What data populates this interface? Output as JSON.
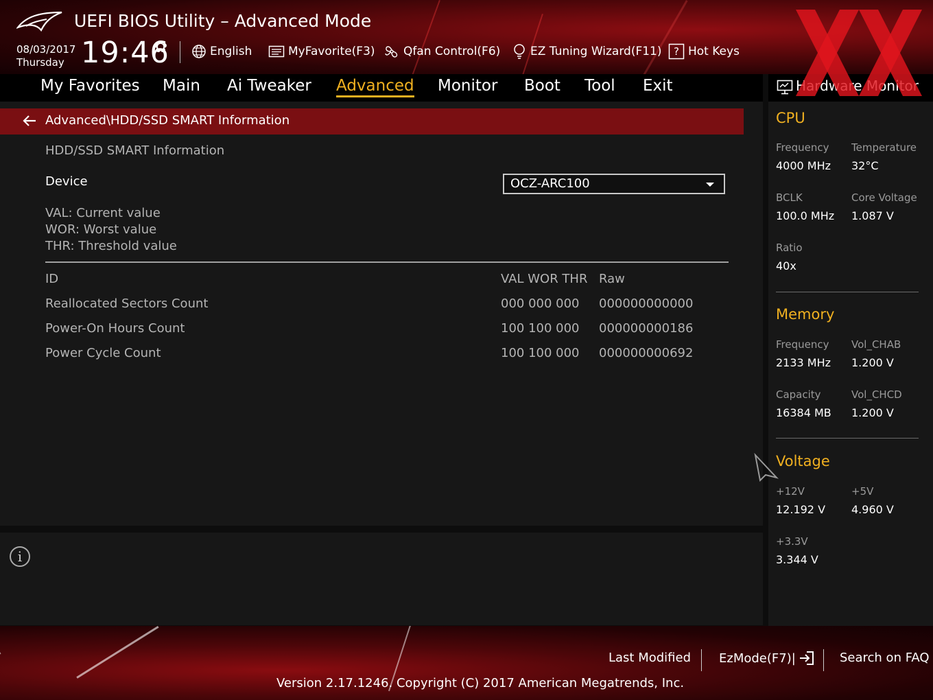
{
  "header": {
    "title": "UEFI BIOS Utility – Advanced Mode",
    "date": "08/03/2017",
    "weekday": "Thursday",
    "time": "19:46",
    "toolbar": {
      "language": "English",
      "my_favorite": "MyFavorite(F3)",
      "qfan": "Qfan Control(F6)",
      "ez_tuning": "EZ Tuning Wizard(F11)",
      "hot_keys": "Hot Keys"
    }
  },
  "nav": {
    "tabs": [
      "My Favorites",
      "Main",
      "Ai Tweaker",
      "Advanced",
      "Monitor",
      "Boot",
      "Tool",
      "Exit"
    ],
    "active": "Advanced"
  },
  "main": {
    "breadcrumb": "Advanced\\HDD/SSD SMART Information",
    "section_title": "HDD/SSD SMART Information",
    "device_label": "Device",
    "device_value": "OCZ-ARC100",
    "legend": [
      "VAL:  Current value",
      "WOR: Worst value",
      "THR:  Threshold value"
    ],
    "table": {
      "headers": {
        "id": "ID",
        "vals": "VAL WOR THR",
        "raw": "Raw"
      },
      "rows": [
        {
          "name": "Reallocated Sectors Count",
          "vals": "000  000  000",
          "raw": "000000000000"
        },
        {
          "name": "Power-On Hours Count",
          "vals": "100  100  000",
          "raw": "000000000186"
        },
        {
          "name": "Power Cycle Count",
          "vals": "100  100  000",
          "raw": "000000000692"
        }
      ]
    }
  },
  "hardware_monitor": {
    "title": "Hardware Monitor",
    "cpu": {
      "title": "CPU",
      "frequency_label": "Frequency",
      "frequency": "4000 MHz",
      "temperature_label": "Temperature",
      "temperature": "32°C",
      "bclk_label": "BCLK",
      "bclk": "100.0 MHz",
      "core_voltage_label": "Core Voltage",
      "core_voltage": "1.087 V",
      "ratio_label": "Ratio",
      "ratio": "40x"
    },
    "memory": {
      "title": "Memory",
      "frequency_label": "Frequency",
      "frequency": "2133 MHz",
      "vol_chab_label": "Vol_CHAB",
      "vol_chab": "1.200 V",
      "capacity_label": "Capacity",
      "capacity": "16384 MB",
      "vol_chcd_label": "Vol_CHCD",
      "vol_chcd": "1.200 V"
    },
    "voltage": {
      "title": "Voltage",
      "v12_label": "+12V",
      "v12": "12.192 V",
      "v5_label": "+5V",
      "v5": "4.960 V",
      "v33_label": "+3.3V",
      "v33": "3.344 V"
    }
  },
  "footer": {
    "last_modified": "Last Modified",
    "ez_mode": "EzMode(F7)|",
    "search_faq": "Search on FAQ",
    "version": "Version 2.17.1246. Copyright (C) 2017 American Megatrends, Inc."
  },
  "colors": {
    "accent": "#f0b020",
    "breadcrumb_bg": "#7a0f12",
    "panel_bg": "#171717",
    "brand_red": "#c8141c"
  }
}
